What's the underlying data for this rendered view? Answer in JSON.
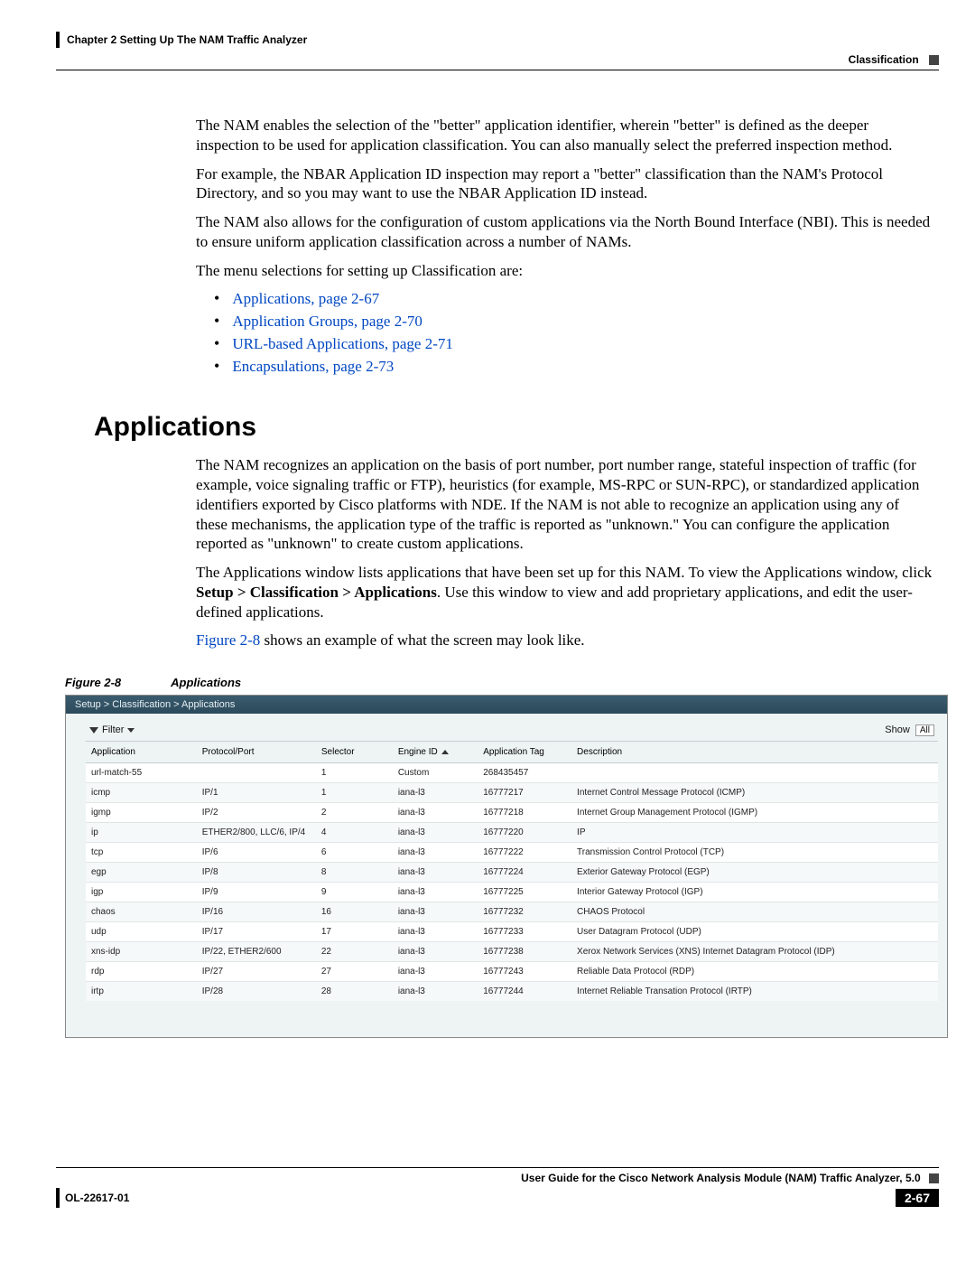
{
  "header": {
    "chapter": "Chapter 2      Setting Up The NAM Traffic Analyzer",
    "section": "Classification"
  },
  "intro": {
    "p1": "The NAM enables the selection of the \"better\" application identifier, wherein \"better\" is defined as the deeper inspection to be used for application classification. You can also manually select the preferred inspection method.",
    "p2": "For example, the NBAR Application ID inspection may report a \"better\" classification than the NAM's Protocol Directory, and so you may want to use the NBAR Application ID instead.",
    "p3": "The NAM also allows for the configuration of custom applications via the North Bound Interface (NBI). This is needed to ensure uniform application classification across a number of NAMs.",
    "p4": "The menu selections for setting up Classification are:"
  },
  "links": [
    "Applications, page 2-67",
    "Application Groups, page 2-70",
    "URL-based Applications, page 2-71",
    "Encapsulations, page 2-73"
  ],
  "heading": "Applications",
  "apps": {
    "p1": "The NAM recognizes an application on the basis of port number, port number range, stateful inspection of traffic (for example, voice signaling traffic or FTP), heuristics (for example, MS-RPC or SUN-RPC), or standardized application identifiers exported by Cisco platforms with NDE. If the NAM is not able to recognize an application using any of these mechanisms, the application type of the traffic is reported as \"unknown.\" You can configure the application reported as \"unknown\" to create custom applications.",
    "p2a": "The Applications window lists applications that have been set up for this NAM. To view the Applications window, click ",
    "p2bold": "Setup > Classification > Applications",
    "p2b": ". Use this window to view and add proprietary applications, and edit the user-defined applications.",
    "p3a": "Figure 2-8",
    "p3b": " shows an example of what the screen may look like."
  },
  "figcaption": {
    "num": "Figure 2-8",
    "title": "Applications"
  },
  "screenshot": {
    "breadcrumb": "Setup > Classification > Applications",
    "filter_label": "Filter",
    "show_label": "Show",
    "show_value": "All",
    "headers": [
      "Application",
      "Protocol/Port",
      "Selector",
      "Engine ID",
      "Application Tag",
      "Description"
    ],
    "rows": [
      {
        "app": "url-match-55",
        "proto": "",
        "sel": "1",
        "eng": "Custom",
        "tag": "268435457",
        "desc": ""
      },
      {
        "app": "icmp",
        "proto": "IP/1",
        "sel": "1",
        "eng": "iana-l3",
        "tag": "16777217",
        "desc": "Internet Control Message Protocol (ICMP)"
      },
      {
        "app": "igmp",
        "proto": "IP/2",
        "sel": "2",
        "eng": "iana-l3",
        "tag": "16777218",
        "desc": "Internet Group Management Protocol (IGMP)"
      },
      {
        "app": "ip",
        "proto": "ETHER2/800, LLC/6, IP/4",
        "sel": "4",
        "eng": "iana-l3",
        "tag": "16777220",
        "desc": "IP"
      },
      {
        "app": "tcp",
        "proto": "IP/6",
        "sel": "6",
        "eng": "iana-l3",
        "tag": "16777222",
        "desc": "Transmission Control Protocol (TCP)"
      },
      {
        "app": "egp",
        "proto": "IP/8",
        "sel": "8",
        "eng": "iana-l3",
        "tag": "16777224",
        "desc": "Exterior Gateway Protocol (EGP)"
      },
      {
        "app": "igp",
        "proto": "IP/9",
        "sel": "9",
        "eng": "iana-l3",
        "tag": "16777225",
        "desc": "Interior Gateway Protocol (IGP)"
      },
      {
        "app": "chaos",
        "proto": "IP/16",
        "sel": "16",
        "eng": "iana-l3",
        "tag": "16777232",
        "desc": "CHAOS Protocol"
      },
      {
        "app": "udp",
        "proto": "IP/17",
        "sel": "17",
        "eng": "iana-l3",
        "tag": "16777233",
        "desc": "User Datagram Protocol (UDP)"
      },
      {
        "app": "xns-idp",
        "proto": "IP/22, ETHER2/600",
        "sel": "22",
        "eng": "iana-l3",
        "tag": "16777238",
        "desc": "Xerox Network Services (XNS) Internet Datagram Protocol (IDP)"
      },
      {
        "app": "rdp",
        "proto": "IP/27",
        "sel": "27",
        "eng": "iana-l3",
        "tag": "16777243",
        "desc": "Reliable Data Protocol (RDP)"
      },
      {
        "app": "irtp",
        "proto": "IP/28",
        "sel": "28",
        "eng": "iana-l3",
        "tag": "16777244",
        "desc": "Internet Reliable Transation Protocol (IRTP)"
      }
    ]
  },
  "footer": {
    "guide": "User Guide for the Cisco Network Analysis Module (NAM) Traffic Analyzer, 5.0",
    "doc": "OL-22617-01",
    "page": "2-67"
  }
}
